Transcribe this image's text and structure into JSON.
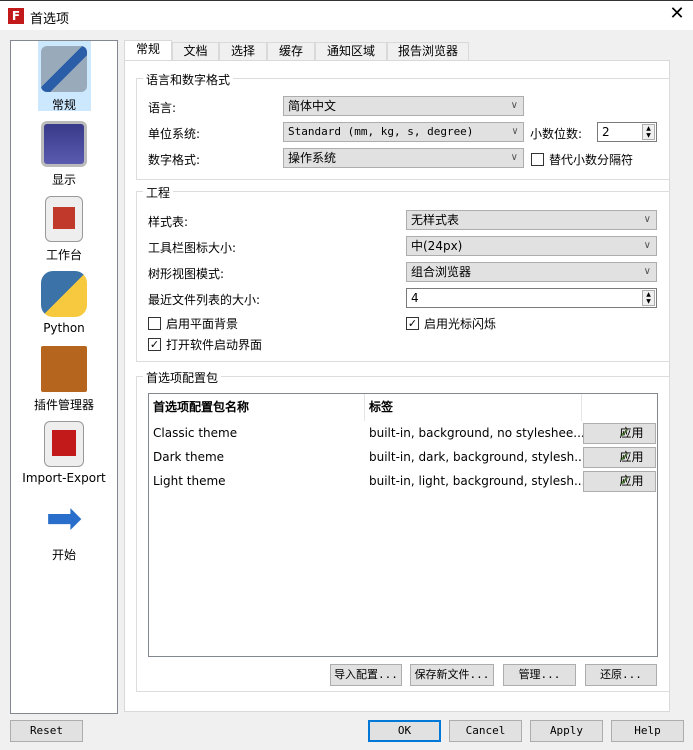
{
  "window": {
    "title": "首选项",
    "close": "✕"
  },
  "sidebar": {
    "items": [
      {
        "label": "常规",
        "icon": "wrench-screwdriver-icon"
      },
      {
        "label": "显示",
        "icon": "monitor-icon"
      },
      {
        "label": "工作台",
        "icon": "workbench-icon"
      },
      {
        "label": "Python",
        "icon": "python-icon"
      },
      {
        "label": "插件管理器",
        "icon": "addon-box-icon"
      },
      {
        "label": "Import-Export",
        "icon": "import-export-icon"
      },
      {
        "label": "开始",
        "icon": "arrow-right-icon"
      }
    ]
  },
  "tabs": [
    "常规",
    "文档",
    "选择",
    "缓存",
    "通知区域",
    "报告浏览器"
  ],
  "lang_group": {
    "title": "语言和数字格式",
    "language_label": "语言:",
    "language": "简体中文",
    "unit_label": "单位系统:",
    "unit": "Standard (mm, kg, s, degree)",
    "decimals_label": "小数位数:",
    "decimals": "2",
    "number_format_label": "数字格式:",
    "number_format": "操作系统",
    "alt_decimal_label": "替代小数分隔符",
    "alt_decimal_checked": false
  },
  "project_group": {
    "title": "工程",
    "stylesheet_label": "样式表:",
    "stylesheet": "无样式表",
    "toolbar_icon_label": "工具栏图标大小:",
    "toolbar_icon": "中(24px)",
    "tree_mode_label": "树形视图模式:",
    "tree_mode": "组合浏览器",
    "recent_label": "最近文件列表的大小:",
    "recent": "4",
    "tiled_bg_label": "启用平面背景",
    "tiled_bg": false,
    "cursor_blink_label": "启用光标闪烁",
    "cursor_blink": true,
    "splash_label": "打开软件启动界面",
    "splash": true
  },
  "packs_group": {
    "title": "首选项配置包",
    "columns": [
      "首选项配置包名称",
      "标签"
    ],
    "rows": [
      {
        "name": "Classic theme",
        "tags": "built-in, background, no styleshee...",
        "apply": "应用"
      },
      {
        "name": "Dark theme",
        "tags": "built-in, dark, background, stylesh...",
        "apply": "应用"
      },
      {
        "name": "Light theme",
        "tags": "built-in, light, background, stylesh...",
        "apply": "应用"
      }
    ],
    "buttons": [
      "导入配置...",
      "保存新文件...",
      "管理...",
      "还原..."
    ]
  },
  "footer": {
    "reset": "Reset",
    "ok": "OK",
    "cancel": "Cancel",
    "apply": "Apply",
    "help": "Help"
  }
}
